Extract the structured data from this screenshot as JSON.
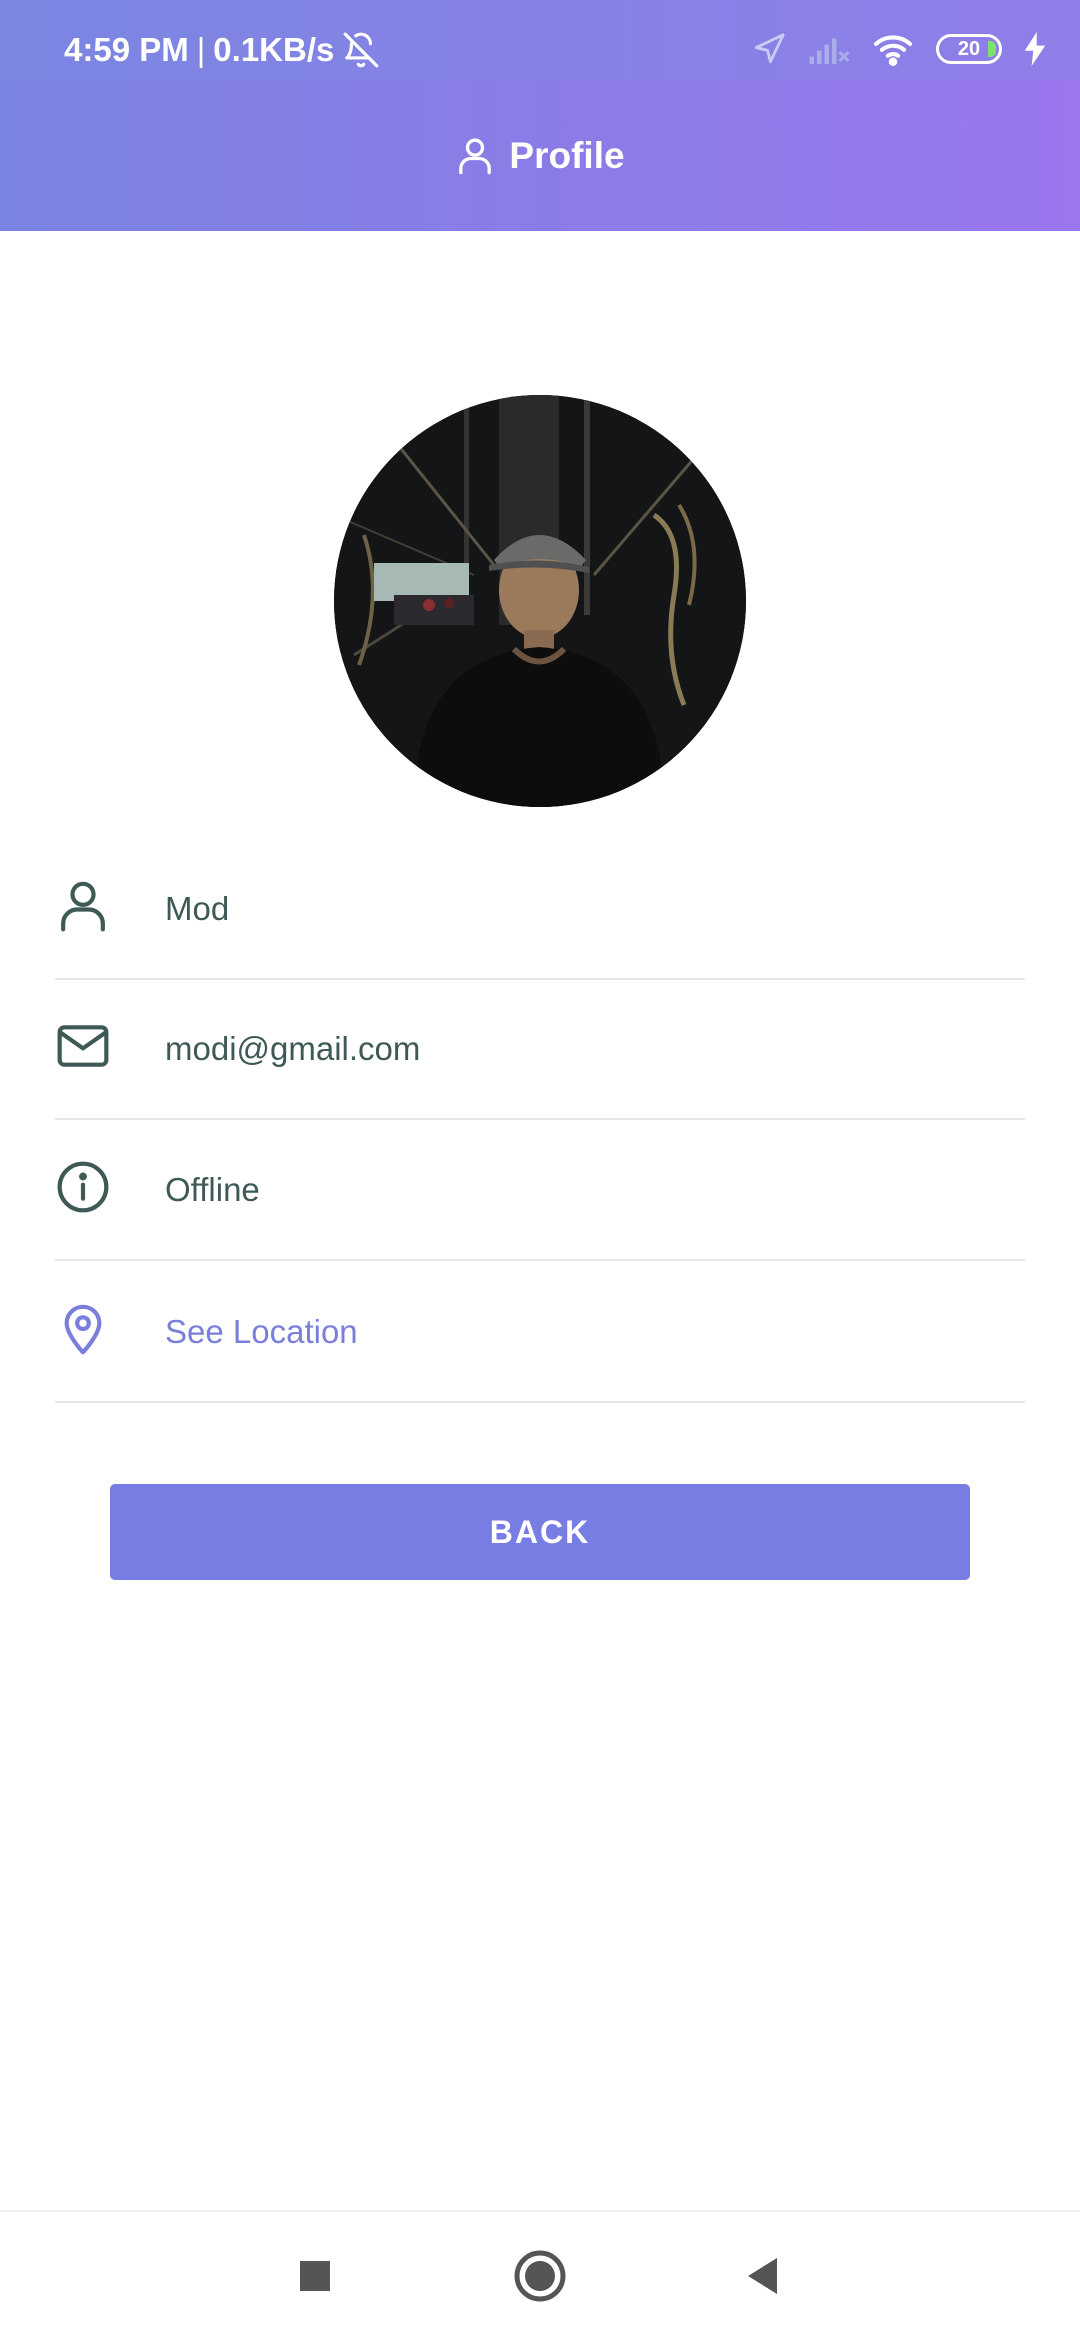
{
  "status_bar": {
    "time": "4:59 PM",
    "separator": "|",
    "network_speed": "0.1KB/s",
    "battery": "20",
    "icons": [
      "bell-off-icon",
      "location-arrow-icon",
      "signal-off-icon",
      "wifi-icon",
      "battery-icon",
      "charging-bolt-icon"
    ]
  },
  "header": {
    "title": "Profile",
    "icon": "person-icon"
  },
  "profile": {
    "avatar": "profile-photo",
    "name": "Mod",
    "email": "modi@gmail.com",
    "status": "Offline",
    "location_link": "See Location"
  },
  "actions": {
    "back_label": "BACK"
  },
  "colors": {
    "accent": "#777de3",
    "header_start": "#7a83df",
    "header_end": "#9a76ef",
    "text": "#3f5a56",
    "link": "#7b7fdc"
  },
  "nav_bar": {
    "icons": [
      "recents-square-icon",
      "home-circle-icon",
      "back-triangle-icon"
    ]
  }
}
